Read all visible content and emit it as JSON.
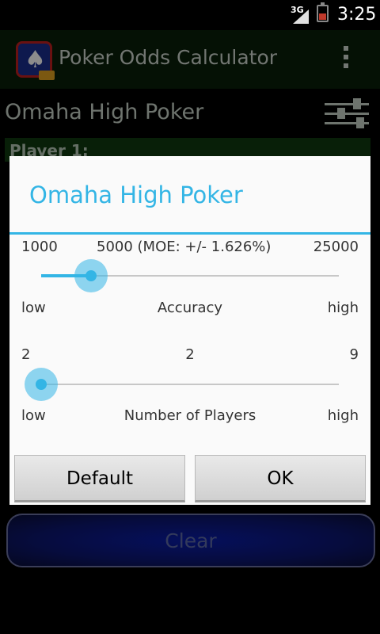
{
  "status_bar": {
    "network": "3G",
    "time": "3:25"
  },
  "action_bar": {
    "title": "Poker Odds Calculator"
  },
  "background": {
    "section_title": "Omaha High Poker",
    "player_label": "Player 1:",
    "clear_label": "Clear"
  },
  "dialog": {
    "title": "Omaha High Poker",
    "accuracy": {
      "min": "1000",
      "current": "5000 (MOE: +/- 1.626%)",
      "max": "25000",
      "low": "low",
      "name": "Accuracy",
      "high": "high",
      "value": 5000,
      "range": [
        1000,
        25000
      ]
    },
    "players": {
      "min": "2",
      "current": "2",
      "max": "9",
      "low": "low",
      "name": "Number of Players",
      "high": "high",
      "value": 2,
      "range": [
        2,
        9
      ]
    },
    "buttons": {
      "default": "Default",
      "ok": "OK"
    }
  },
  "colors": {
    "accent": "#33b5e5",
    "action_bar": "#0a1f0a",
    "clear_button": "#0a1da8"
  }
}
